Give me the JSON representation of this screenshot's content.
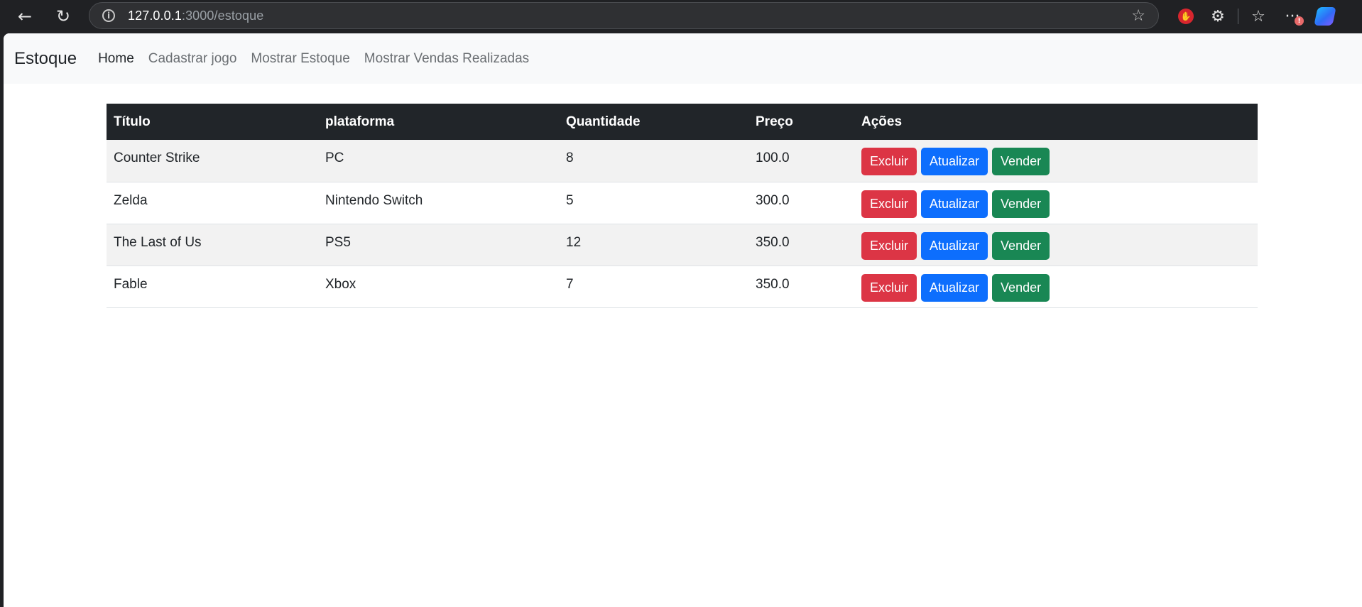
{
  "browser": {
    "back_icon": "←",
    "reload_icon": "↻",
    "url_host": "127.0.0.1",
    "url_rest": ":3000/estoque",
    "star_icon": "☆",
    "extensions": {
      "stop_icon": "✋",
      "puzzle_icon": "⚙",
      "favorites_icon": "☆",
      "more_icon": "···",
      "notification": "!"
    }
  },
  "navbar": {
    "brand": "Estoque",
    "links": [
      {
        "label": "Home"
      },
      {
        "label": "Cadastrar jogo"
      },
      {
        "label": "Mostrar Estoque"
      },
      {
        "label": "Mostrar Vendas Realizadas"
      }
    ]
  },
  "table": {
    "headers": [
      "Título",
      "plataforma",
      "Quantidade",
      "Preço",
      "Ações"
    ],
    "rows": [
      {
        "titulo": "Counter Strike",
        "plataforma": "PC",
        "quantidade": "8",
        "preco": "100.0"
      },
      {
        "titulo": "Zelda",
        "plataforma": "Nintendo Switch",
        "quantidade": "5",
        "preco": "300.0"
      },
      {
        "titulo": "The Last of Us",
        "plataforma": "PS5",
        "quantidade": "12",
        "preco": "350.0"
      },
      {
        "titulo": "Fable",
        "plataforma": "Xbox",
        "quantidade": "7",
        "preco": "350.0"
      }
    ],
    "actions": {
      "delete_label": "Excluir",
      "update_label": "Atualizar",
      "sell_label": "Vender"
    }
  },
  "colors": {
    "navbar_bg": "#f8f9fa",
    "table_header_bg": "#212529",
    "danger": "#dc3545",
    "primary": "#0d6efd",
    "success": "#198754"
  }
}
